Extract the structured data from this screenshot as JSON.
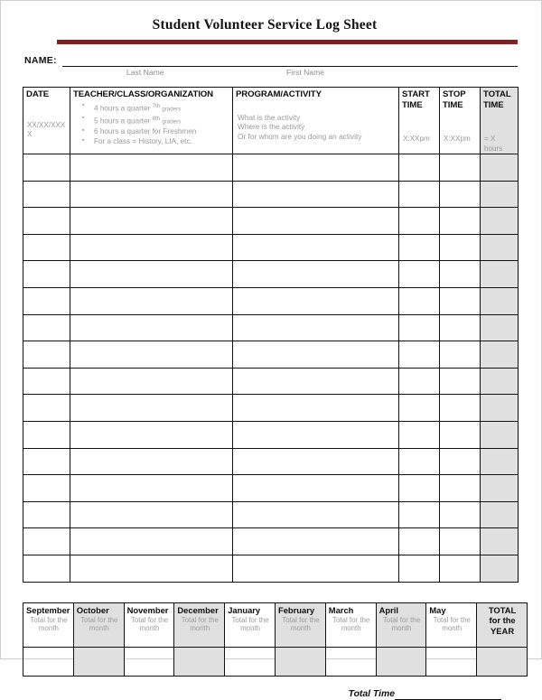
{
  "document": {
    "title": "Student Volunteer Service Log Sheet",
    "accent_color": "#7B2222"
  },
  "name_field": {
    "label": "NAME:",
    "value": "",
    "sub_last": "Last Name",
    "sub_first": "First Name"
  },
  "log_table": {
    "headers": {
      "date": "DATE",
      "teacher": "TEACHER/CLASS/ORGANIZATION",
      "program": "PROGRAM/ACTIVITY",
      "start": "START TIME",
      "stop": "STOP TIME",
      "total": "TOTAL TIME"
    },
    "header_lines": {
      "start_1": "START",
      "start_2": "TIME",
      "stop_1": "STOP",
      "stop_2": "TIME",
      "total_1": "TOTAL",
      "total_2": "TIME"
    },
    "sample_row": {
      "date": "XX/XX/XXXX",
      "teacher_bullets": [
        {
          "text": "4 hours a quarter",
          "sup": "7",
          "sup_ord": "th",
          "sup_note": "graders"
        },
        {
          "text": "5 hours a quarter",
          "sup": "8",
          "sup_ord": "th",
          "sup_note": "graders"
        },
        {
          "text": "6 hours a quarter for Freshmen",
          "sup": "",
          "sup_ord": "",
          "sup_note": ""
        },
        {
          "text": "For a class = History, LIA, etc.",
          "sup": "",
          "sup_ord": "",
          "sup_note": ""
        }
      ],
      "program_lines": [
        "What is the activity",
        "Where is the activity",
        "Or for whom are you doing an activity"
      ],
      "start_time": "X:XXpm",
      "stop_time": "X:XXpm",
      "total_time": "= X hours"
    },
    "blank_row_count": 16,
    "shaded_column": "total"
  },
  "months_table": {
    "sub_label": "Total for the month",
    "sub_label_lines": [
      "Total for the",
      "month"
    ],
    "columns": [
      {
        "name": "September",
        "sub": "Total for the month",
        "shaded": false
      },
      {
        "name": "October",
        "sub": "Total for the month",
        "shaded": true
      },
      {
        "name": "November",
        "sub": "Total for the month",
        "shaded": false
      },
      {
        "name": "December",
        "sub": "Total for the month",
        "shaded": true
      },
      {
        "name": "January",
        "sub": "Total for the month",
        "shaded": false
      },
      {
        "name": "February",
        "sub": "Total for the month",
        "shaded": true
      },
      {
        "name": "March",
        "sub": "Total for the month",
        "shaded": false
      },
      {
        "name": "April",
        "sub": "Total for the month",
        "shaded": true
      },
      {
        "name": "May",
        "sub": "Total for the month",
        "shaded": false
      }
    ],
    "total_column": {
      "line_1": "TOTAL",
      "line_2": "for the",
      "line_3": "YEAR",
      "shaded": true
    }
  },
  "footer": {
    "total_time_label": "Total Time",
    "total_time_value": ""
  }
}
